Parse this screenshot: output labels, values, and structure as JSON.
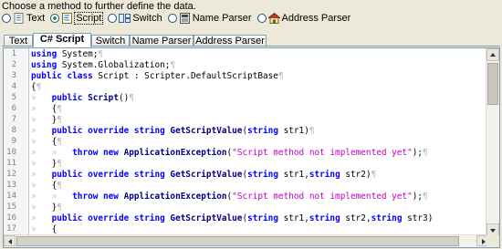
{
  "prompt": "Choose a method to further define the data.",
  "methods": [
    {
      "label": "Text",
      "icon": "text-document-icon",
      "checked": false
    },
    {
      "label": "Script",
      "icon": "script-icon",
      "checked": true
    },
    {
      "label": "Switch",
      "icon": "switch-icon",
      "checked": false
    },
    {
      "label": "Name Parser",
      "icon": "name-parser-icon",
      "checked": false
    },
    {
      "label": "Address Parser",
      "icon": "address-parser-icon",
      "checked": false
    }
  ],
  "tabs": [
    {
      "label": "Text",
      "active": false
    },
    {
      "label": "C# Script",
      "active": true
    },
    {
      "label": "Switch",
      "active": false
    },
    {
      "label": "Name Parser",
      "active": false
    },
    {
      "label": "Address Parser",
      "active": false
    }
  ],
  "editor": {
    "line_numbers": [
      "1",
      "2",
      "3",
      "4",
      "5",
      "6",
      "7",
      "8",
      "9",
      "10",
      "11",
      "12",
      "13",
      "14",
      "15",
      "16",
      "17"
    ],
    "lines": [
      [
        [
          "kw",
          "using"
        ],
        [
          "pl",
          " System;"
        ],
        [
          "ws",
          "¶"
        ]
      ],
      [
        [
          "kw",
          "using"
        ],
        [
          "pl",
          " System.Globalization;"
        ],
        [
          "ws",
          "¶"
        ]
      ],
      [
        [
          "kw",
          "public class"
        ],
        [
          "pl",
          " Script : Scripter.DefaultScriptBase"
        ],
        [
          "ws",
          "¶"
        ]
      ],
      [
        [
          "pl",
          "{"
        ],
        [
          "ws",
          "¶"
        ]
      ],
      [
        [
          "ws",
          "»   "
        ],
        [
          "kw",
          "public"
        ],
        [
          "pl",
          " "
        ],
        [
          "fn",
          "Script"
        ],
        [
          "pl",
          "()"
        ],
        [
          "ws",
          "¶"
        ]
      ],
      [
        [
          "ws",
          "»   "
        ],
        [
          "pl",
          "{"
        ],
        [
          "ws",
          "¶"
        ]
      ],
      [
        [
          "ws",
          "»   "
        ],
        [
          "pl",
          "}"
        ],
        [
          "ws",
          "¶"
        ]
      ],
      [
        [
          "ws",
          "»   "
        ],
        [
          "kw",
          "public override string"
        ],
        [
          "pl",
          " "
        ],
        [
          "fn",
          "GetScriptValue"
        ],
        [
          "pl",
          "("
        ],
        [
          "kw",
          "string"
        ],
        [
          "pl",
          " str1)"
        ],
        [
          "ws",
          "¶"
        ]
      ],
      [
        [
          "ws",
          "»   "
        ],
        [
          "pl",
          "{"
        ],
        [
          "ws",
          "¶"
        ]
      ],
      [
        [
          "ws",
          "»   »   "
        ],
        [
          "kw",
          "throw new"
        ],
        [
          "pl",
          " "
        ],
        [
          "fn",
          "ApplicationException"
        ],
        [
          "pl",
          "("
        ],
        [
          "str",
          "\"Script method not implemented yet\""
        ],
        [
          "pl",
          ");"
        ],
        [
          "ws",
          "¶"
        ]
      ],
      [
        [
          "ws",
          "»   "
        ],
        [
          "pl",
          "}"
        ],
        [
          "ws",
          "¶"
        ]
      ],
      [
        [
          "ws",
          "»   "
        ],
        [
          "kw",
          "public override string"
        ],
        [
          "pl",
          " "
        ],
        [
          "fn",
          "GetScriptValue"
        ],
        [
          "pl",
          "("
        ],
        [
          "kw",
          "string"
        ],
        [
          "pl",
          " str1,"
        ],
        [
          "kw",
          "string"
        ],
        [
          "pl",
          " str2)"
        ],
        [
          "ws",
          "¶"
        ]
      ],
      [
        [
          "ws",
          "»   "
        ],
        [
          "pl",
          "{"
        ],
        [
          "ws",
          "¶"
        ]
      ],
      [
        [
          "ws",
          "»   »   "
        ],
        [
          "kw",
          "throw new"
        ],
        [
          "pl",
          " "
        ],
        [
          "fn",
          "ApplicationException"
        ],
        [
          "pl",
          "("
        ],
        [
          "str",
          "\"Script method not implemented yet\""
        ],
        [
          "pl",
          ");"
        ],
        [
          "ws",
          "¶"
        ]
      ],
      [
        [
          "ws",
          "»   "
        ],
        [
          "pl",
          "}"
        ],
        [
          "ws",
          "¶"
        ]
      ],
      [
        [
          "ws",
          "»   "
        ],
        [
          "kw",
          "public override string"
        ],
        [
          "pl",
          " "
        ],
        [
          "fn",
          "GetScriptValue"
        ],
        [
          "pl",
          "("
        ],
        [
          "kw",
          "string"
        ],
        [
          "pl",
          " str1,"
        ],
        [
          "kw",
          "string"
        ],
        [
          "pl",
          " str2,"
        ],
        [
          "kw",
          "string"
        ],
        [
          "pl",
          " str3)"
        ]
      ],
      [
        [
          "ws",
          "»   "
        ],
        [
          "pl",
          "{"
        ]
      ]
    ]
  },
  "colors": {
    "keyword": "#0000ff",
    "string": "#c000c0",
    "whitespace_marker": "#c0c0c0"
  }
}
